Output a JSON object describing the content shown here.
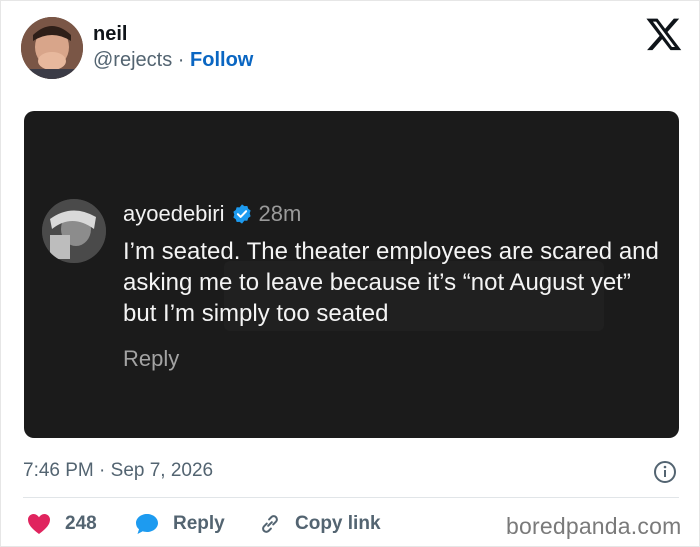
{
  "author": {
    "name": "neil",
    "handle": "@rejects",
    "separator": "·",
    "follow_label": "Follow",
    "avatar_icon": "user-avatar"
  },
  "brand": {
    "logo_icon": "x-logo-icon"
  },
  "embedded_post": {
    "username": "ayoedebiri",
    "verified_icon": "verified-badge-icon",
    "time_ago": "28m",
    "text": "I’m seated. The theater employees are scared and asking me to leave because it’s “not August yet” but I’m simply too seated",
    "reply_label": "Reply",
    "background": "#1b1b1b"
  },
  "meta": {
    "timestamp": "7:46 PM · Sep 7, 2026",
    "info_icon": "info-icon"
  },
  "actions": {
    "like_count": "248",
    "reply_label": "Reply",
    "copy_label": "Copy link"
  },
  "watermark": "boredpanda.com",
  "colors": {
    "like": "#e0245e",
    "reply": "#1d9bf0",
    "follow": "#0a66c2",
    "verified": "#1d9bf0"
  }
}
